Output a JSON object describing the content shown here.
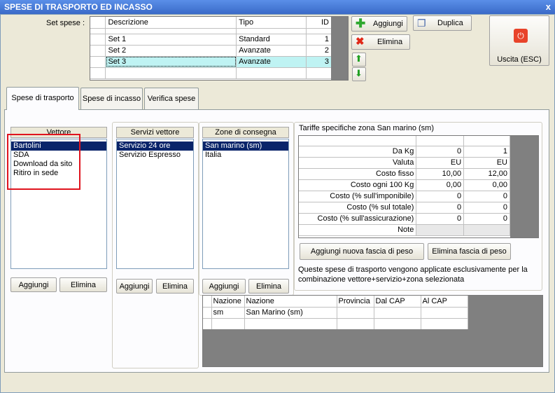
{
  "window": {
    "title": "SPESE DI TRASPORTO ED INCASSO",
    "close": "x"
  },
  "setspese": {
    "label": "Set spese :",
    "columns": [
      "Descrizione",
      "Tipo",
      "ID"
    ],
    "rows": [
      {
        "desc": "Set 1",
        "tipo": "Standard",
        "id": "1"
      },
      {
        "desc": "Set 2",
        "tipo": "Avanzate",
        "id": "2"
      },
      {
        "desc": "Set 3",
        "tipo": "Avanzate",
        "id": "3"
      }
    ]
  },
  "buttons": {
    "aggiungi": "Aggiungi",
    "duplica": "Duplica",
    "elimina": "Elimina",
    "uscita": "Uscita (ESC)",
    "vettore_aggiungi": "Aggiungi",
    "vettore_elimina": "Elimina",
    "servizi_aggiungi": "Aggiungi",
    "servizi_elimina": "Elimina",
    "zone_aggiungi": "Aggiungi",
    "zone_elimina": "Elimina",
    "aggiungi_fascia": "Aggiungi nuova fascia di peso",
    "elimina_fascia": "Elimina fascia di peso"
  },
  "tabs": [
    "Spese di trasporto",
    "Spese di incasso",
    "Verifica spese"
  ],
  "vettore": {
    "header": "Vettore",
    "items": [
      "Bartolini",
      "SDA",
      "Download da sito",
      "Ritiro in sede"
    ]
  },
  "servizi": {
    "header": "Servizi vettore",
    "items": [
      "Servizio 24 ore",
      "Servizio Espresso"
    ]
  },
  "zone": {
    "header": "Zone di consegna",
    "items": [
      "San marino (sm)",
      "Italia"
    ]
  },
  "tariffe": {
    "title": "Tariffe specifiche zona San marino (sm)",
    "rows": [
      {
        "label": "Da Kg",
        "v1": "0",
        "v2": "1"
      },
      {
        "label": "Valuta",
        "v1": "EU",
        "v2": "EU"
      },
      {
        "label": "Costo fisso",
        "v1": "10,00",
        "v2": "12,00"
      },
      {
        "label": "Costo ogni 100 Kg",
        "v1": "0,00",
        "v2": "0,00"
      },
      {
        "label": "Costo (% sull'imponibile)",
        "v1": "0",
        "v2": "0"
      },
      {
        "label": "Costo (% sul totale)",
        "v1": "0",
        "v2": "0"
      },
      {
        "label": "Costo (% sull'assicurazione)",
        "v1": "0",
        "v2": "0"
      },
      {
        "label": "Note",
        "v1": "",
        "v2": ""
      }
    ],
    "info": "Queste spese di trasporto vengono applicate esclusivamente per la combinazione vettore+servizio+zona selezionata"
  },
  "nazioni": {
    "columns": [
      "Nazione",
      "Nazione",
      "Provincia",
      "Dal CAP",
      "Al CAP"
    ],
    "rows": [
      {
        "code": "sm",
        "name": "San Marino (sm)",
        "prov": "",
        "dal": "",
        "al": ""
      }
    ]
  },
  "colors": {
    "highlight_border": "#e0141e",
    "selected_row": "#bff3f3",
    "list_selection": "#0a246a"
  }
}
